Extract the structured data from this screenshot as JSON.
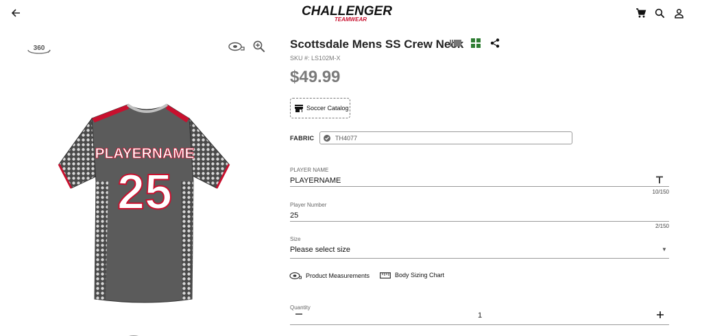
{
  "header": {
    "logo_main": "CHALLENGER",
    "logo_sub": "TEAMWEAR",
    "icons": [
      "back-arrow-icon",
      "cart-icon",
      "search-icon",
      "account-icon"
    ]
  },
  "viewer": {
    "view_360_label": "360",
    "jersey": {
      "player_name": "PLAYERNAME",
      "number": "25"
    }
  },
  "product": {
    "title": "Scottsdale Mens SS Crew Neck",
    "sku": "SKU #: LS102M-X",
    "price": "$49.99",
    "catalog_button": "Soccer Catalog",
    "fabric_label": "FABRIC",
    "fabric_value": "TH4077"
  },
  "form": {
    "player_name": {
      "label": "PLAYER NAME",
      "value": "PLAYERNAME",
      "counter": "10/150"
    },
    "player_number": {
      "label": "Player Number",
      "value": "25",
      "counter": "2/150"
    },
    "size": {
      "label": "Size",
      "value": "Please select size"
    },
    "product_measurements": "Product Measurements",
    "body_sizing_chart": "Body Sizing Chart",
    "quantity": {
      "label": "Quantity",
      "value": "1"
    }
  },
  "colors": {
    "brand_red": "#c8102e",
    "grid_green": "#2e7d32",
    "jersey_gray": "#5a5a5a"
  }
}
